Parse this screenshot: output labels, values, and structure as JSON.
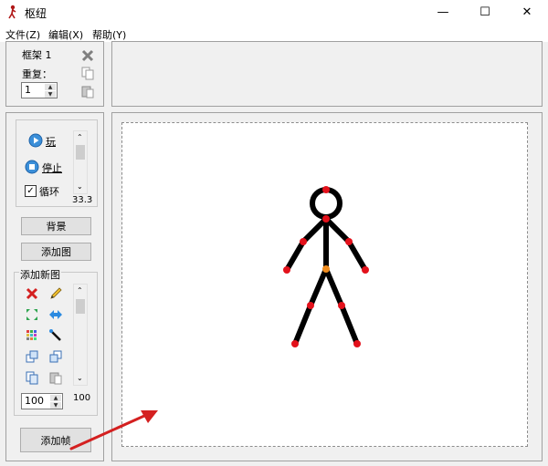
{
  "window": {
    "title": "枢纽",
    "minimize": "—",
    "maximize": "☐",
    "close": "✕"
  },
  "menu": [
    "文件(Z)",
    "编辑(X)",
    "帮助(Y)"
  ],
  "frame_panel": {
    "frame_label": "框架 1",
    "repeat_label": "重复：",
    "repeat_value": "1"
  },
  "playback": {
    "play_label": "玩",
    "stop_label": "停止",
    "loop_label": "循环",
    "loop_checked": true,
    "speed_value": "33.3"
  },
  "buttons": {
    "background": "背景",
    "add_image": "添加图"
  },
  "add_figure": {
    "title": "添加新图",
    "size_value": "100",
    "scroll_value": "100"
  },
  "add_frame_button": "添加帧",
  "colors": {
    "joint_red": "#e3111b",
    "joint_orange": "#f08c1e",
    "arrow_red": "#d42020",
    "figure": "#000000"
  }
}
